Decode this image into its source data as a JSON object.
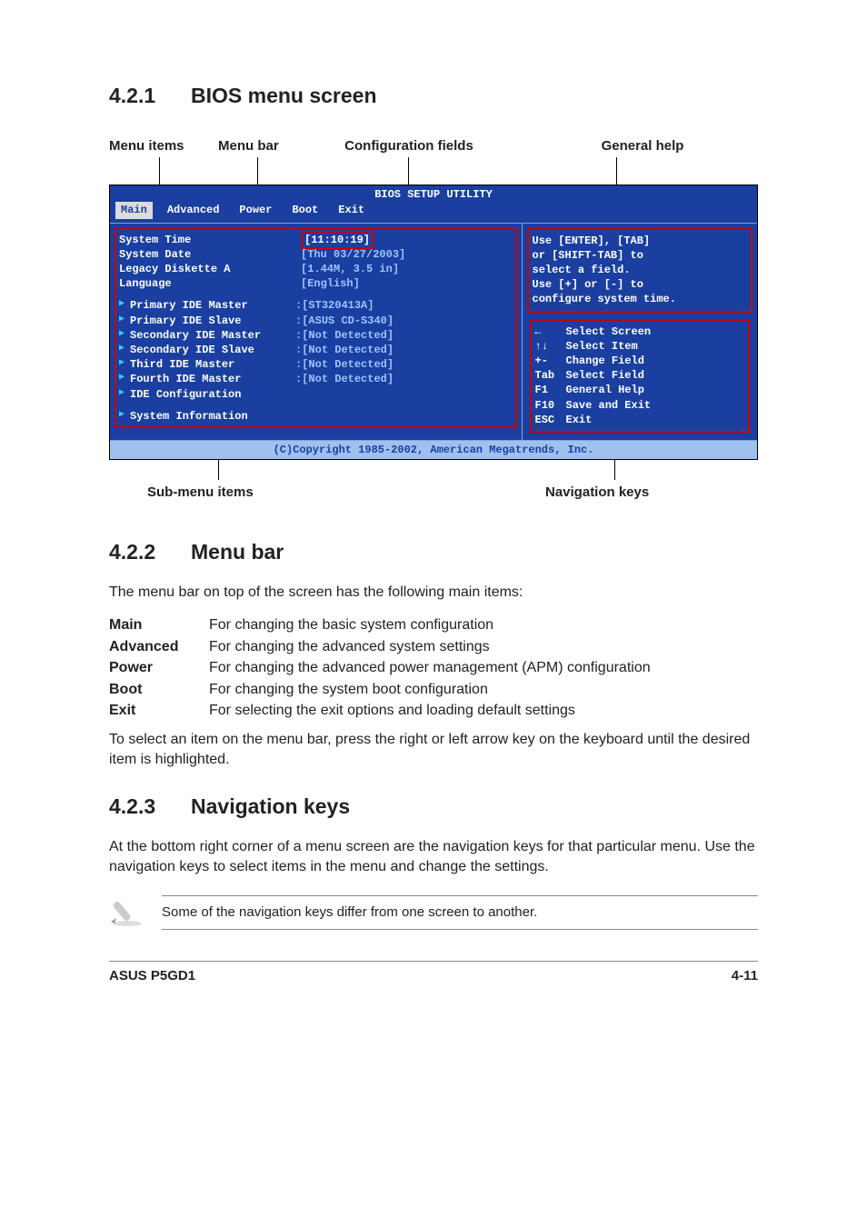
{
  "sec1": {
    "num": "4.2.1",
    "title": "BIOS menu screen"
  },
  "anno_top": {
    "a1": "Menu items",
    "a2": "Menu bar",
    "a3": "Configuration fields",
    "a4": "General help"
  },
  "bios": {
    "title": "BIOS SETUP UTILITY",
    "tabs": [
      "Main",
      "Advanced",
      "Power",
      "Boot",
      "Exit"
    ],
    "left": {
      "top": [
        {
          "label": "System Time",
          "value": "[11:10:19]"
        },
        {
          "label": "System Date",
          "value": "[Thu 03/27/2003]"
        },
        {
          "label": "Legacy Diskette A",
          "value": "[1.44M, 3.5 in]"
        },
        {
          "label": "Language",
          "value": "[English]"
        }
      ],
      "sub": [
        {
          "label": "Primary IDE Master",
          "value": ":[ST320413A]"
        },
        {
          "label": "Primary IDE Slave",
          "value": ":[ASUS CD-S340]"
        },
        {
          "label": "Secondary IDE Master",
          "value": ":[Not Detected]"
        },
        {
          "label": "Secondary IDE Slave",
          "value": ":[Not Detected]"
        },
        {
          "label": "Third IDE Master",
          "value": ":[Not Detected]"
        },
        {
          "label": "Fourth IDE Master",
          "value": ":[Not Detected]"
        },
        {
          "label": "IDE Configuration",
          "value": ""
        }
      ],
      "sys_info": "System Information"
    },
    "help": {
      "lines": [
        "Use [ENTER], [TAB]",
        "or [SHIFT-TAB] to",
        "select a field.",
        "",
        "Use [+] or [-] to",
        "configure system time."
      ],
      "nav": [
        {
          "k": "←",
          "d": "Select Screen"
        },
        {
          "k": "↑↓",
          "d": "Select Item"
        },
        {
          "k": "+-",
          "d": "Change Field"
        },
        {
          "k": "Tab",
          "d": "Select Field"
        },
        {
          "k": "F1",
          "d": "General Help"
        },
        {
          "k": "F10",
          "d": "Save and Exit"
        },
        {
          "k": "ESC",
          "d": "Exit"
        }
      ]
    },
    "footer": "(C)Copyright 1985-2002, American Megatrends, Inc."
  },
  "anno_bot": {
    "b1": "Sub-menu items",
    "b2": "Navigation keys"
  },
  "sec2": {
    "num": "4.2.2",
    "title": "Menu bar",
    "intro": "The menu bar on top of the screen has the following main items:",
    "items": [
      {
        "t": "Main",
        "d": "For changing the basic system configuration"
      },
      {
        "t": "Advanced",
        "d": "For changing the advanced system settings"
      },
      {
        "t": "Power",
        "d": "For changing the advanced power management (APM) configuration"
      },
      {
        "t": "Boot",
        "d": "For changing the system boot configuration"
      },
      {
        "t": "Exit",
        "d": "For selecting the exit options and loading default settings"
      }
    ],
    "outro": "To select an item on the menu bar, press the right or left arrow key on the keyboard until the desired item is highlighted."
  },
  "sec3": {
    "num": "4.2.3",
    "title": "Navigation keys",
    "body": "At the bottom right corner of a menu screen are the navigation keys for that particular menu. Use the navigation keys to select items in the menu and change the settings.",
    "note": "Some of the navigation keys differ from one screen to another."
  },
  "footer": {
    "left": "ASUS P5GD1",
    "right": "4-11"
  }
}
